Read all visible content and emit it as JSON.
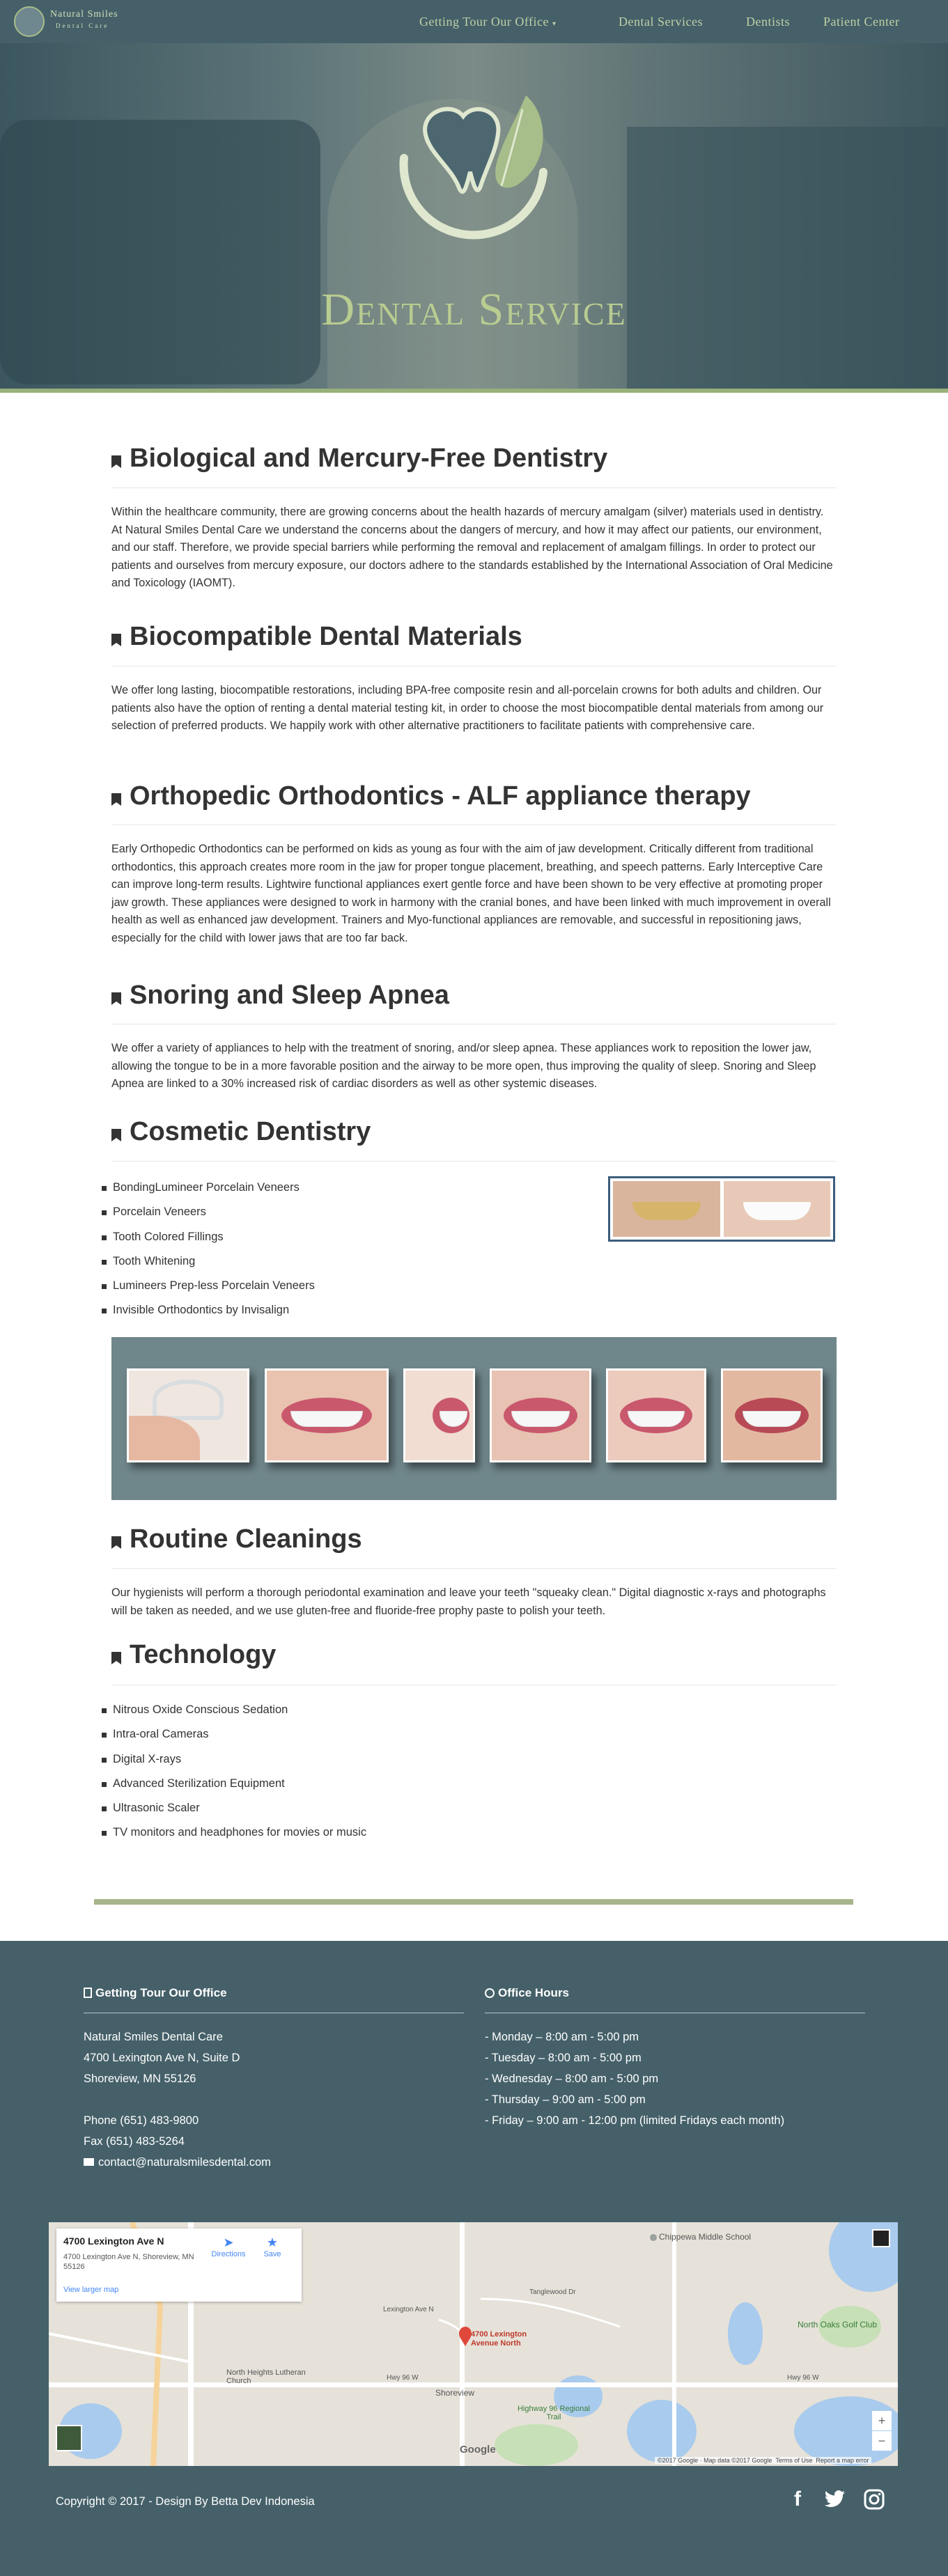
{
  "nav": {
    "logo_line1": "Natural Smiles",
    "logo_line2": "Dental Care",
    "items": [
      {
        "label": "Getting Tour Our Office"
      },
      {
        "label": "Dental Services"
      },
      {
        "label": "Dentists"
      },
      {
        "label": "Patient Center"
      }
    ]
  },
  "hero": {
    "title": "Dental Service"
  },
  "sections": {
    "biological": {
      "title": "Biological and Mercury-Free Dentistry",
      "text": "Within the healthcare community, there are growing concerns about the health hazards of mercury amalgam (silver) materials used in dentistry. At Natural Smiles Dental Care we understand the concerns about the dangers of mercury, and how it may affect our patients, our environment, and our staff. Therefore, we provide special barriers while performing the removal and replacement of amalgam fillings. In order to protect our patients and ourselves from mercury exposure, our doctors adhere to the standards established by the International Association of Oral Medicine and Toxicology (IAOMT)."
    },
    "biocompatible": {
      "title": "Biocompatible Dental Materials",
      "text": "We offer long lasting, biocompatible restorations, including BPA-free composite resin and all-porcelain crowns for both adults and children. Our patients also have the option of renting a dental material testing kit, in order to choose the most biocompatible dental materials from among our selection of preferred products. We happily work with other alternative practitioners to facilitate patients with comprehensive care."
    },
    "orthopedic": {
      "title": "Orthopedic Orthodontics - ALF appliance therapy",
      "text": "Early Orthopedic Orthodontics can be performed on kids as young as four with the aim of jaw development. Critically different from traditional orthodontics, this approach creates more room in the jaw for proper tongue placement, breathing, and speech patterns. Early Interceptive Care can improve long-term results. Lightwire functional appliances exert gentle force and have been shown to be very effective at promoting proper jaw growth. These appliances were designed to work in harmony with the cranial bones, and have been linked with much improvement in overall health as well as enhanced jaw development. Trainers and Myo-functional appliances are removable, and successful in repositioning jaws, especially for the child with lower jaws that are too far back."
    },
    "snoring": {
      "title": "Snoring and Sleep Apnea",
      "text": "We offer a variety of appliances to help with the treatment of snoring, and/or sleep apnea. These appliances work to reposition the lower jaw, allowing the tongue to be in a more favorable position and the airway to be more open, thus improving the quality of sleep. Snoring and Sleep Apnea are linked to a 30% increased risk of cardiac disorders as well as other systemic diseases."
    },
    "cosmetic": {
      "title": "Cosmetic Dentistry",
      "items": [
        "BondingLumineer Porcelain Veneers",
        "Porcelain Veneers",
        "Tooth Colored Fillings",
        "Tooth Whitening",
        "Lumineers Prep-less Porcelain Veneers",
        "Invisible Orthodontics by Invisalign"
      ]
    },
    "cleanings": {
      "title": "Routine Cleanings",
      "text": "Our hygienists will perform a thorough periodontal examination and leave your teeth \"squeaky clean.\" Digital diagnostic x-rays and photographs will be taken as needed, and we use gluten-free and fluoride-free prophy paste to polish your teeth."
    },
    "technology": {
      "title": "Technology",
      "items": [
        "Nitrous Oxide Conscious Sedation",
        "Intra-oral Cameras",
        "Digital X-rays",
        "Advanced Sterilization Equipment",
        "Ultrasonic Scaler",
        "TV monitors and headphones for movies or music"
      ]
    }
  },
  "footer": {
    "office": {
      "title": "Getting Tour Our Office",
      "name": "Natural Smiles Dental Care",
      "address1": "4700 Lexington Ave N, Suite D",
      "address2": "Shoreview, MN 55126",
      "phone": "Phone (651) 483-9800",
      "fax": "Fax (651) 483-5264",
      "email": "contact@naturalsmilesdental.com"
    },
    "hours": {
      "title": "Office Hours",
      "lines": [
        "- Monday – 8:00 am - 5:00 pm",
        "- Tuesday – 8:00 am - 5:00 pm",
        "- Wednesday – 8:00 am - 5:00 pm",
        "- Thursday – 9:00 am - 5:00 pm",
        "- Friday – 9:00 am - 12:00 pm (limited Fridays each month)"
      ]
    },
    "copyright": "Copyright © 2017 - Design By Betta Dev Indonesia"
  },
  "map": {
    "card_title": "4700 Lexington Ave N",
    "card_address": "4700 Lexington Ave N, Shoreview, MN 55126",
    "directions": "Directions",
    "save": "Save",
    "larger_map": "View larger map",
    "marker_label": "4700 Lexington Avenue North",
    "places": {
      "school": "Chippewa Middle School",
      "golf": "North Oaks Golf Club",
      "church": "North Heights Lutheran Church",
      "shoreview": "Shoreview",
      "trail": "Highway 96 Regional Trail",
      "google": "Google"
    },
    "roads": {
      "hwy96_west": "Hwy 96 W",
      "hwy96_east": "Hwy 96 W",
      "tanglewood": "Tanglewood Dr",
      "lexington": "Lexington Ave N"
    },
    "attribution": "©2017 Google · Map data ©2017 Google",
    "terms": "Terms of Use",
    "report": "Report a map error",
    "zoom_in": "+",
    "zoom_out": "−"
  },
  "colors": {
    "nav_bg": "#456069",
    "accent_green": "#98b07a",
    "footer_bg": "#456069"
  },
  "icons": {
    "section": "bookmark-icon",
    "office": "building-icon",
    "hours": "clock-icon",
    "email": "envelope-icon",
    "social": [
      "facebook-icon",
      "twitter-icon",
      "instagram-icon"
    ]
  }
}
